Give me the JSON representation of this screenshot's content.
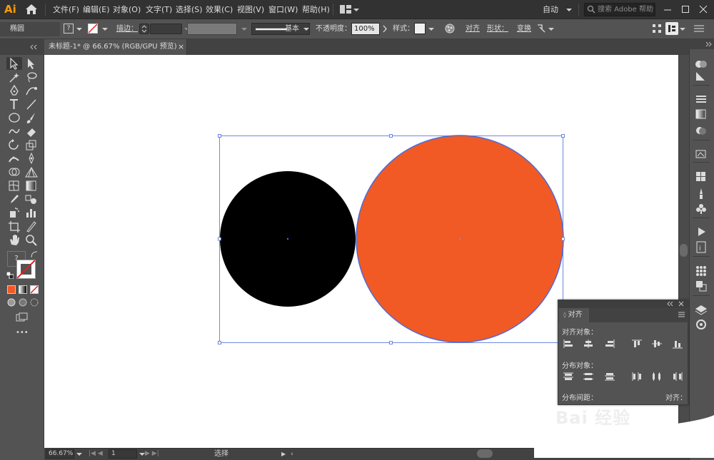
{
  "app": {
    "logo": "Ai"
  },
  "menu": {
    "items": [
      "文件(F)",
      "编辑(E)",
      "对象(O)",
      "文字(T)",
      "选择(S)",
      "效果(C)",
      "视图(V)",
      "窗口(W)",
      "帮助(H)"
    ],
    "workspace": "自动",
    "search_placeholder": "搜索 Adobe 帮助"
  },
  "control": {
    "object_type": "椭圆",
    "fill_label": "?",
    "stroke_label": "描边：",
    "stroke_profile": "基本",
    "opacity_label": "不透明度：",
    "opacity_value": "100%",
    "style_label": "样式：",
    "align_label": "对齐",
    "shape_label": "形状：",
    "transform_label": "变换"
  },
  "document": {
    "tab_title": "未标题-1* @ 66.67% (RGB/GPU 预览)",
    "close": "×"
  },
  "toolbar": {
    "fill_label": "?",
    "more": "•••"
  },
  "canvas": {
    "selection_color": "#4b6bdc",
    "shapes": [
      {
        "name": "black-circle",
        "fill": "#000000"
      },
      {
        "name": "orange-circle",
        "fill": "#f15a24"
      }
    ]
  },
  "align_panel": {
    "tab": "对齐",
    "align_objects_label": "对齐对象：",
    "distribute_objects_label": "分布对象：",
    "distribute_spacing_label": "分布间距：",
    "align_to_label": "对齐："
  },
  "status": {
    "zoom": "66.67%",
    "artboard": "1",
    "tool": "选择"
  },
  "watermark": {
    "text": "Bai 经验"
  }
}
